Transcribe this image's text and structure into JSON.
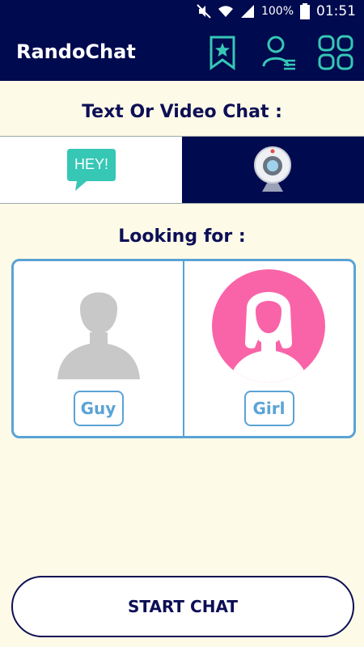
{
  "status": {
    "battery": "100%",
    "time": "01:51"
  },
  "appbar": {
    "title": "RandoChat"
  },
  "chat_mode": {
    "heading": "Text Or Video Chat :",
    "text_option": {
      "bubble_text": "HEY!"
    },
    "video_option": {}
  },
  "looking_for": {
    "heading": "Looking for :",
    "guy_label": "Guy",
    "girl_label": "Girl"
  },
  "start_button": {
    "label": "START CHAT"
  },
  "colors": {
    "primary": "#000a4e",
    "accent": "#5aa3d6",
    "teal": "#36c7b5",
    "pink": "#f964a8",
    "background": "#fefae8"
  }
}
